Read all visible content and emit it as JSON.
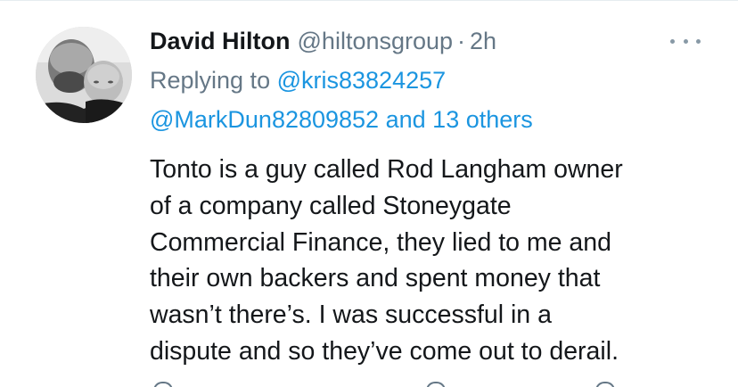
{
  "tweet": {
    "author": {
      "display_name": "David Hilton",
      "handle": "@hiltonsgroup",
      "separator": "·",
      "timestamp": "2h",
      "avatar_icon": "profile-photo-man-with-baby"
    },
    "reply": {
      "prefix": "Replying to",
      "mention_1": "@kris83824257",
      "mention_2": "@MarkDun82809852",
      "conjunction": "and",
      "others": "13 others"
    },
    "text_lines": [
      "Tonto is a guy called Rod Langham owner",
      "of a company called Stoneygate",
      "Commercial Finance, they lied to me and",
      "their own backers and spent money that",
      "wasn’t there’s. I was successful in a",
      "dispute and so they’ve come out to derail."
    ],
    "more_icon": "more-horizontal-icon"
  },
  "colors": {
    "text_primary": "#14171a",
    "text_secondary": "#657786",
    "link": "#1b95e0",
    "divider": "#e6ecf0"
  }
}
